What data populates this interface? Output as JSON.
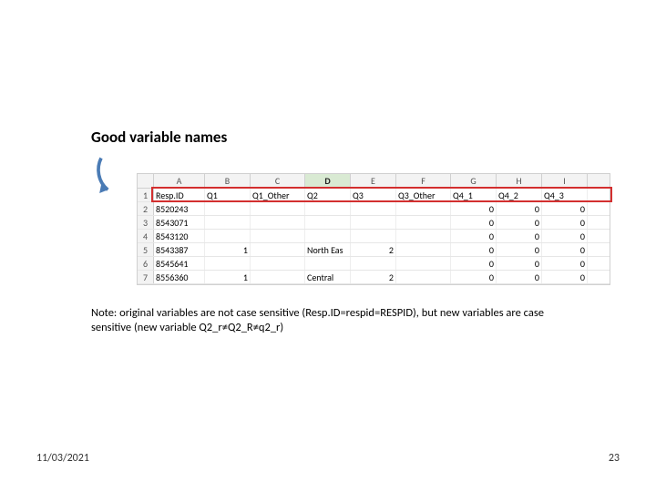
{
  "title": "Good variable names",
  "columns_letters": [
    "A",
    "B",
    "C",
    "D",
    "E",
    "F",
    "G",
    "H",
    "I"
  ],
  "selected_col": "D",
  "col_widths": [
    "c1",
    "c2",
    "c3",
    "c4",
    "c5",
    "c6",
    "c7",
    "c8",
    "c9"
  ],
  "header_row": [
    "Resp.ID",
    "Q1",
    "Q1_Other",
    "Q2",
    "Q3",
    "Q3_Other",
    "Q4_1",
    "Q4_2",
    "Q4_3"
  ],
  "rows": [
    {
      "n": "1",
      "cells": [
        "Resp.ID",
        "Q1",
        "Q1_Other",
        "Q2",
        "Q3",
        "Q3_Other",
        "Q4_1",
        "Q4_2",
        "Q4_3"
      ],
      "align": [
        "l",
        "l",
        "l",
        "l",
        "l",
        "l",
        "l",
        "l",
        "l"
      ]
    },
    {
      "n": "2",
      "cells": [
        "8520243",
        "",
        "",
        "",
        "",
        "",
        "0",
        "0",
        "0"
      ],
      "align": [
        "l",
        "l",
        "l",
        "l",
        "l",
        "l",
        "r",
        "r",
        "r"
      ]
    },
    {
      "n": "3",
      "cells": [
        "8543071",
        "",
        "",
        "",
        "",
        "",
        "0",
        "0",
        "0"
      ],
      "align": [
        "l",
        "l",
        "l",
        "l",
        "l",
        "l",
        "r",
        "r",
        "r"
      ]
    },
    {
      "n": "4",
      "cells": [
        "8543120",
        "",
        "",
        "",
        "",
        "",
        "0",
        "0",
        "0"
      ],
      "align": [
        "l",
        "l",
        "l",
        "l",
        "l",
        "l",
        "r",
        "r",
        "r"
      ]
    },
    {
      "n": "5",
      "cells": [
        "8543387",
        "1",
        "",
        "North Eas",
        "2",
        "",
        "0",
        "0",
        "0"
      ],
      "align": [
        "l",
        "r",
        "l",
        "l",
        "r",
        "l",
        "r",
        "r",
        "r"
      ]
    },
    {
      "n": "6",
      "cells": [
        "8545641",
        "",
        "",
        "",
        "",
        "",
        "0",
        "0",
        "0"
      ],
      "align": [
        "l",
        "l",
        "l",
        "l",
        "l",
        "l",
        "r",
        "r",
        "r"
      ]
    },
    {
      "n": "7",
      "cells": [
        "8556360",
        "1",
        "",
        "Central",
        "2",
        "",
        "0",
        "0",
        "0"
      ],
      "align": [
        "l",
        "r",
        "l",
        "l",
        "r",
        "l",
        "r",
        "r",
        "r"
      ]
    }
  ],
  "note": "Note: original variables are not case sensitive (Resp.ID=respid=RESPID), but new variables are case sensitive (new variable Q2_r≠Q2_R≠q2_r)",
  "footer": {
    "date": "11/03/2021",
    "page": "23"
  }
}
